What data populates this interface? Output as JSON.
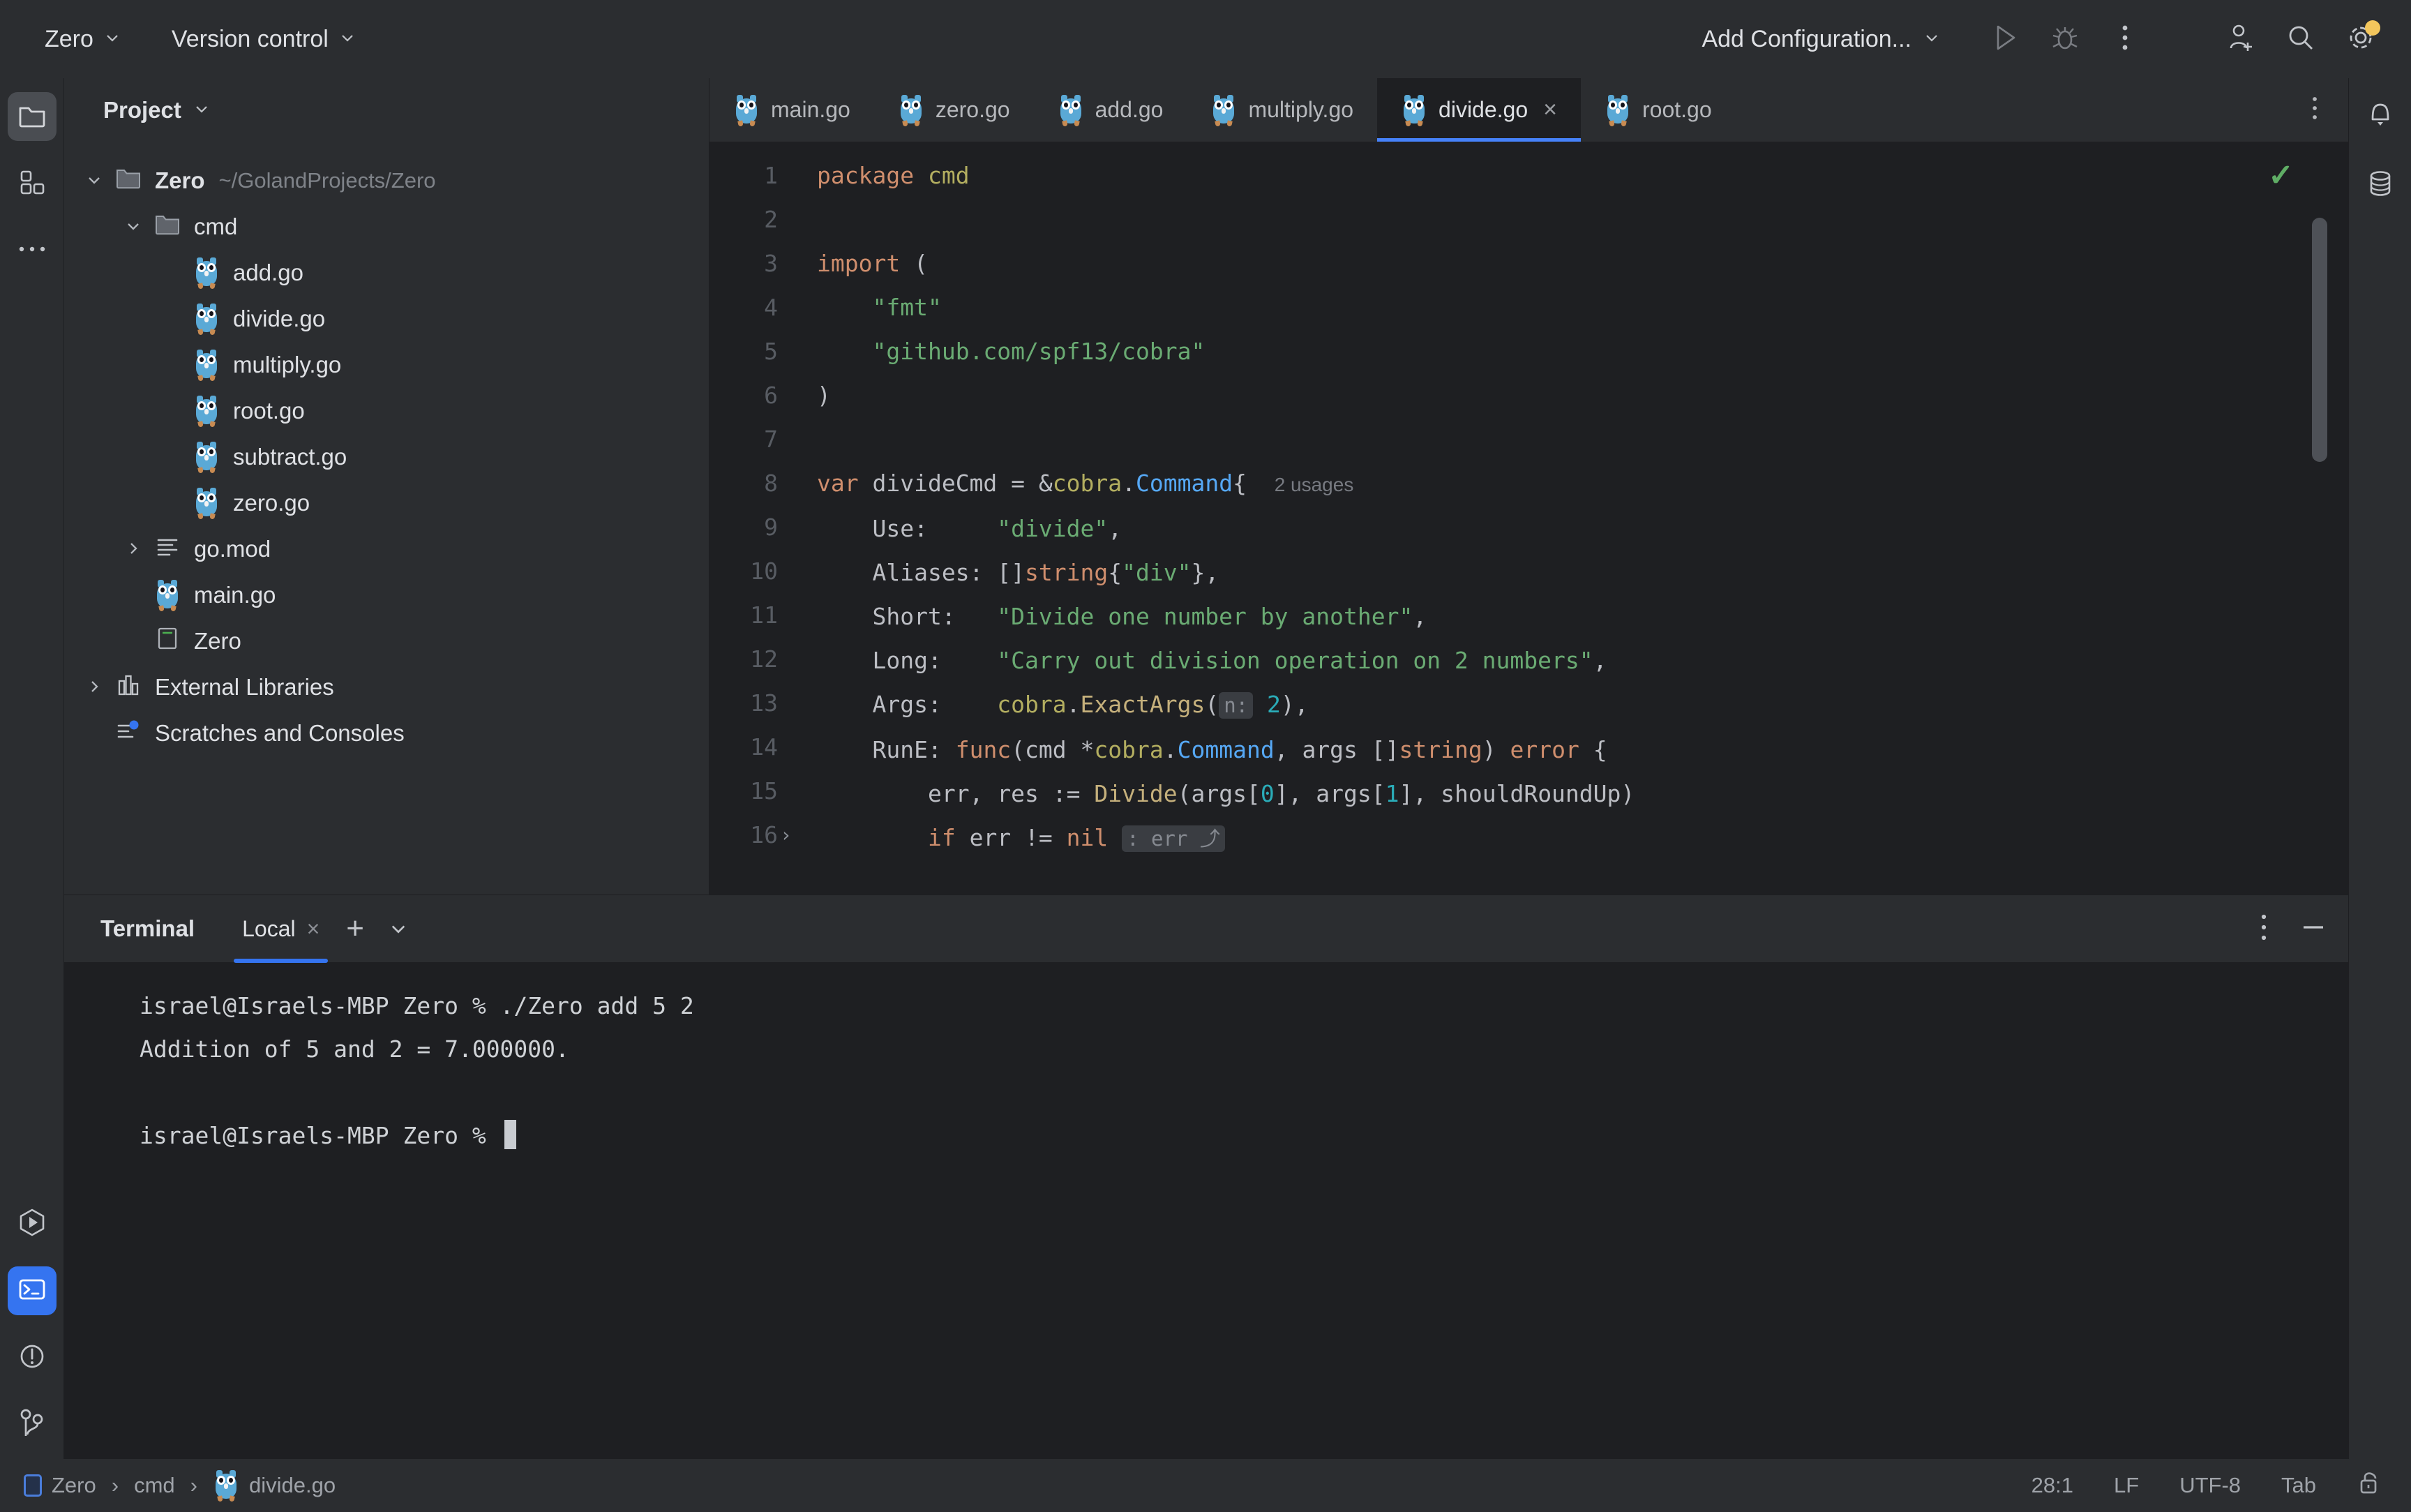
{
  "toolbar": {
    "project_menu": "Zero",
    "vcs_menu": "Version control",
    "run_config": "Add Configuration...",
    "icons": {
      "run": "run-icon",
      "debug": "debug-icon",
      "more": "more-vertical-icon",
      "add_user": "add-user-icon",
      "search": "search-icon",
      "settings": "gear-icon"
    }
  },
  "left_stripe": {
    "items": [
      {
        "name": "project-tool-window",
        "icon": "folder-icon",
        "active": true
      },
      {
        "name": "structure-tool-window",
        "icon": "blocks-icon",
        "active": false
      },
      {
        "name": "more-tool-windows",
        "icon": "ellipsis-icon",
        "active": false
      }
    ],
    "bottom_items": [
      {
        "name": "run-tool-window",
        "icon": "run-hex-icon",
        "active": false
      },
      {
        "name": "terminal-tool-window",
        "icon": "terminal-icon",
        "active": true
      },
      {
        "name": "problems-tool-window",
        "icon": "warning-circle-icon",
        "active": false
      },
      {
        "name": "git-tool-window",
        "icon": "branch-icon",
        "active": false
      }
    ]
  },
  "right_stripe": {
    "items": [
      {
        "name": "notifications",
        "icon": "bell-icon"
      },
      {
        "name": "database",
        "icon": "database-icon"
      }
    ]
  },
  "project_panel": {
    "title": "Project",
    "tree": [
      {
        "indent": 0,
        "arrow": "down",
        "icon": "folder-icon",
        "label": "Zero",
        "bold": true,
        "sub": "~/GolandProjects/Zero"
      },
      {
        "indent": 1,
        "arrow": "down",
        "icon": "folder-icon",
        "label": "cmd",
        "bold": false,
        "sub": ""
      },
      {
        "indent": 2,
        "arrow": "none",
        "icon": "go-file-icon",
        "label": "add.go",
        "bold": false,
        "sub": ""
      },
      {
        "indent": 2,
        "arrow": "none",
        "icon": "go-file-icon",
        "label": "divide.go",
        "bold": false,
        "sub": ""
      },
      {
        "indent": 2,
        "arrow": "none",
        "icon": "go-file-icon",
        "label": "multiply.go",
        "bold": false,
        "sub": ""
      },
      {
        "indent": 2,
        "arrow": "none",
        "icon": "go-file-icon",
        "label": "root.go",
        "bold": false,
        "sub": ""
      },
      {
        "indent": 2,
        "arrow": "none",
        "icon": "go-file-icon",
        "label": "subtract.go",
        "bold": false,
        "sub": ""
      },
      {
        "indent": 2,
        "arrow": "none",
        "icon": "go-file-icon",
        "label": "zero.go",
        "bold": false,
        "sub": ""
      },
      {
        "indent": 1,
        "arrow": "right",
        "icon": "gomod-icon",
        "label": "go.mod",
        "bold": false,
        "sub": ""
      },
      {
        "indent": 1,
        "arrow": "none",
        "icon": "go-file-icon",
        "label": "main.go",
        "bold": false,
        "sub": ""
      },
      {
        "indent": 1,
        "arrow": "none",
        "icon": "binary-icon",
        "label": "Zero",
        "bold": false,
        "sub": ""
      },
      {
        "indent": 0,
        "arrow": "right",
        "icon": "libraries-icon",
        "label": "External Libraries",
        "bold": false,
        "sub": ""
      },
      {
        "indent": 0,
        "arrow": "none",
        "icon": "scratches-icon",
        "label": "Scratches and Consoles",
        "bold": false,
        "sub": ""
      }
    ]
  },
  "editor": {
    "tabs": [
      {
        "label": "main.go",
        "icon": "go-file-icon",
        "active": false,
        "closable": false
      },
      {
        "label": "zero.go",
        "icon": "go-file-icon",
        "active": false,
        "closable": false
      },
      {
        "label": "add.go",
        "icon": "go-file-icon",
        "active": false,
        "closable": false
      },
      {
        "label": "multiply.go",
        "icon": "go-file-icon",
        "active": false,
        "closable": false
      },
      {
        "label": "divide.go",
        "icon": "go-file-icon",
        "active": true,
        "closable": true,
        "close_glyph": "×"
      },
      {
        "label": "root.go",
        "icon": "go-file-icon",
        "active": false,
        "closable": false
      }
    ],
    "inspection_status": "✓",
    "line_numbers": [
      "1",
      "2",
      "3",
      "4",
      "5",
      "6",
      "7",
      "8",
      "9",
      "10",
      "11",
      "12",
      "13",
      "14",
      "15",
      "16"
    ],
    "code_lines": [
      "package cmd",
      "",
      "import (",
      "    \"fmt\"",
      "    \"github.com/spf13/cobra\"",
      ")",
      "",
      "var divideCmd = &cobra.Command{  2 usages",
      "    Use:     \"divide\",",
      "    Aliases: []string{\"div\"},",
      "    Short:   \"Divide one number by another\",",
      "    Long:    \"Carry out division operation on 2 numbers\",",
      "    Args:    cobra.ExactArgs( n: 2),",
      "    RunE: func(cmd *cobra.Command, args []string) error {",
      "        err, res := Divide(args[0], args[1], shouldRoundUp)",
      "        if err != nil : err ⤴"
    ],
    "usages_hint": "2 usages",
    "param_hint": "n:",
    "fold_hint": ": err ⤴",
    "fold_marker": "›"
  },
  "terminal": {
    "title": "Terminal",
    "tab_label": "Local",
    "close_glyph": "×",
    "new_tab_glyph": "+",
    "dropdown_glyph": "∨",
    "options_icon": "more-vertical-icon",
    "minimize_icon": "minimize-icon",
    "output": [
      "israel@Israels-MBP Zero % ./Zero add 5 2",
      "Addition of 5 and 2 = 7.000000.",
      "",
      "israel@Israels-MBP Zero % "
    ]
  },
  "status_bar": {
    "breadcrumbs": [
      {
        "label": "Zero",
        "icon": "module-icon"
      },
      {
        "label": "cmd",
        "icon": "none"
      },
      {
        "label": "divide.go",
        "icon": "go-file-icon"
      }
    ],
    "separator": "›",
    "caret_position": "28:1",
    "line_separator": "LF",
    "encoding": "UTF-8",
    "indent": "Tab",
    "lock_icon": "unlocked-icon"
  },
  "colors": {
    "accent": "#3574f0",
    "tab_underline": "#4682fa",
    "bg_panel": "#2b2d30",
    "bg_editor": "#1e1f22",
    "text": "#dfe1e5",
    "keyword": "#cf8e6d",
    "string": "#6aab73",
    "type": "#56a8f5",
    "number": "#2aacb8",
    "function": "#c5b07c",
    "package": "#b3ae60",
    "ok_check": "#5fad65",
    "gear_badge": "#f2c55c"
  }
}
